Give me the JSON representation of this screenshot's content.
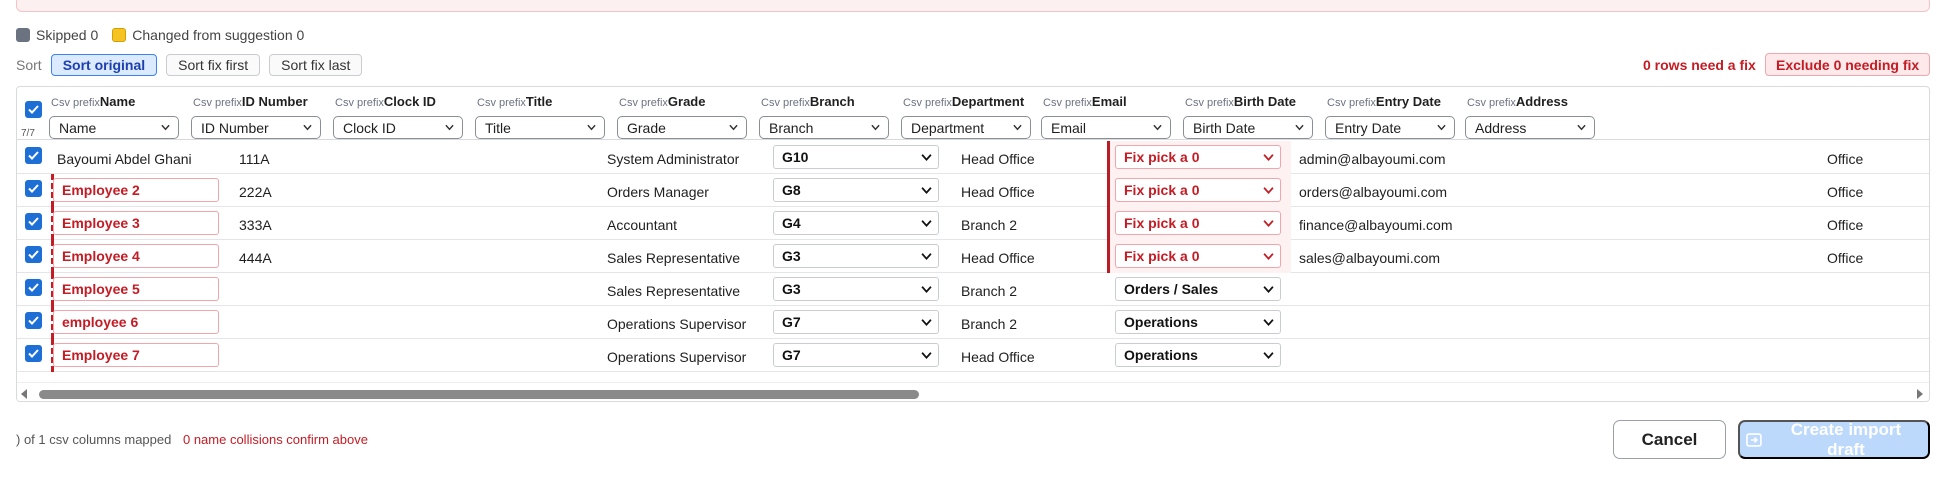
{
  "legend": {
    "skipped": "Skipped 0",
    "changed": "Changed from suggestion 0"
  },
  "sort": {
    "label": "Sort",
    "options": [
      "Sort original",
      "Sort fix first",
      "Sort fix last"
    ],
    "active": "Sort original"
  },
  "status": {
    "rows_need_fix": "0 rows need a fix",
    "exclude_button": "Exclude 0 needing fix"
  },
  "table": {
    "selected_count": "7/7",
    "csv_prefix": "Csv prefix",
    "columns": [
      {
        "name": "Name",
        "mapped": "Name"
      },
      {
        "name": "ID Number",
        "mapped": "ID Number"
      },
      {
        "name": "Clock ID",
        "mapped": "Clock ID"
      },
      {
        "name": "Title",
        "mapped": "Title"
      },
      {
        "name": "Grade",
        "mapped": "Grade"
      },
      {
        "name": "Branch",
        "mapped": "Branch"
      },
      {
        "name": "Department",
        "mapped": "Department"
      },
      {
        "name": "Email",
        "mapped": "Email"
      },
      {
        "name": "Birth Date",
        "mapped": "Birth Date"
      },
      {
        "name": "Entry Date",
        "mapped": "Entry Date"
      },
      {
        "name": "Address",
        "mapped": "Address"
      }
    ],
    "rows": [
      {
        "name": "Bayoumi Abdel Ghani",
        "id": "111A",
        "title": "System Administrator",
        "grade": "G10",
        "branch": "Head Office",
        "department": "Fix pick a 0",
        "email": "admin@albayoumi.com",
        "address": "Office"
      },
      {
        "name": "Employee 2",
        "id": "222A",
        "title": "Orders Manager",
        "grade": "G8",
        "branch": "Head Office",
        "department": "Fix pick a 0",
        "email": "orders@albayoumi.com",
        "address": "Office"
      },
      {
        "name": "Employee 3",
        "id": "333A",
        "title": "Accountant",
        "grade": "G4",
        "branch": "Branch 2",
        "department": "Fix pick a 0",
        "email": "finance@albayoumi.com",
        "address": "Office"
      },
      {
        "name": "Employee 4",
        "id": "444A",
        "title": "Sales Representative",
        "grade": "G3",
        "branch": "Head Office",
        "department": "Fix pick a 0",
        "email": "sales@albayoumi.com",
        "address": "Office"
      },
      {
        "name": "Employee 5",
        "id": "",
        "title": "Sales Representative",
        "grade": "G3",
        "branch": "Branch 2",
        "department": "Orders / Sales",
        "email": "",
        "address": ""
      },
      {
        "name": "employee 6",
        "id": "",
        "title": "Operations Supervisor",
        "grade": "G7",
        "branch": "Branch 2",
        "department": "Operations",
        "email": "",
        "address": ""
      },
      {
        "name": "Employee 7",
        "id": "",
        "title": "Operations Supervisor",
        "grade": "G7",
        "branch": "Head Office",
        "department": "Operations",
        "email": "",
        "address": ""
      }
    ]
  },
  "footer": {
    "mapped": ") of 1 csv columns mapped",
    "collisions": "0 name collisions confirm above",
    "cancel": "Cancel",
    "create": "Create import draft"
  },
  "colors": {
    "accent": "#1d6fd6",
    "error": "#c41c24",
    "disabled": "#bcd8fb"
  }
}
